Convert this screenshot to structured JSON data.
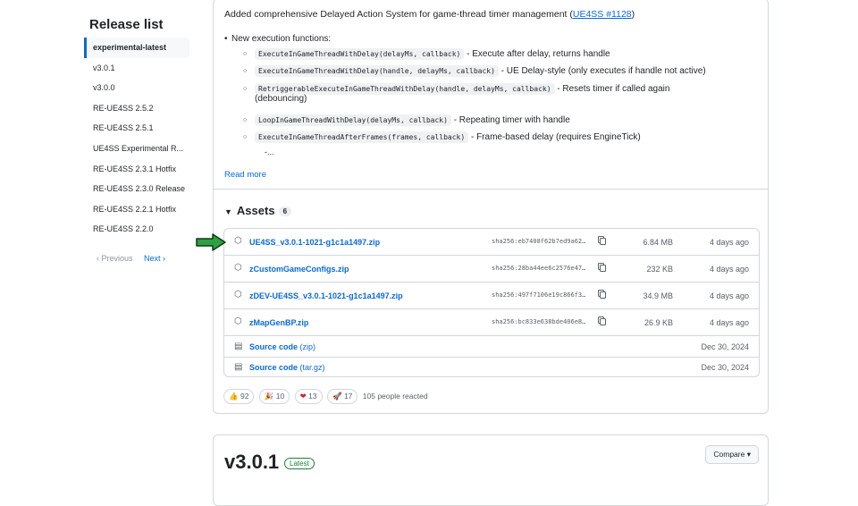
{
  "sidebar": {
    "title": "Release list",
    "items": [
      {
        "label": "experimental-latest",
        "active": true
      },
      {
        "label": "v3.0.1"
      },
      {
        "label": "v3.0.0"
      },
      {
        "label": "RE-UE4SS 2.5.2"
      },
      {
        "label": "RE-UE4SS 2.5.1"
      },
      {
        "label": "UE4SS Experimental R..."
      },
      {
        "label": "RE-UE4SS 2.3.1 Hotfix"
      },
      {
        "label": "RE-UE4SS 2.3.0 Release"
      },
      {
        "label": "RE-UE4SS 2.2.1 Hotfix"
      },
      {
        "label": "RE-UE4SS 2.2.0"
      }
    ],
    "prev_label": "Previous",
    "next_label": "Next"
  },
  "release": {
    "intro_text": "Added comprehensive Delayed Action System for game-thread timer management (",
    "intro_link": "UE4SS #1128",
    "intro_end": ")",
    "bullet": "New execution functions:",
    "subitems": [
      {
        "code": "ExecuteInGameThreadWithDelay(delayMs, callback)",
        "desc": " - Execute after delay, returns handle"
      },
      {
        "code": "ExecuteInGameThreadWithDelay(handle, delayMs, callback)",
        "desc": " - UE Delay-style (only executes if handle not active)"
      },
      {
        "code": "RetriggerableExecuteInGameThreadWithDelay(handle, delayMs, callback)",
        "desc": " - Resets timer if called again",
        "desc2": "(debouncing)"
      },
      {
        "code": "LoopInGameThreadWithDelay(delayMs, callback)",
        "desc": " - Repeating timer with handle"
      },
      {
        "code": "ExecuteInGameThreadAfterFrames(frames, callback)",
        "desc": " - Frame-based delay (requires EngineTick)"
      }
    ],
    "ellipsis": "-...",
    "read_more": "Read more"
  },
  "assets": {
    "heading": "Assets",
    "count": "6",
    "files": [
      {
        "name": "UE4SS_v3.0.1-1021-g1c1a1497.zip",
        "sha": "sha256:eb7408f62b7ed9a62…",
        "size": "6.84 MB",
        "date": "4 days ago",
        "icon": "package-icon"
      },
      {
        "name": "zCustomGameConfigs.zip",
        "sha": "sha256:28ba44ee6c2576e47…",
        "size": "232 KB",
        "date": "4 days ago",
        "icon": "package-icon"
      },
      {
        "name": "zDEV-UE4SS_v3.0.1-1021-g1c1a1497.zip",
        "sha": "sha256:497f7106e19c866f3…",
        "size": "34.9 MB",
        "date": "4 days ago",
        "icon": "package-icon"
      },
      {
        "name": "zMapGenBP.zip",
        "sha": "sha256:bc833e638bde406e8…",
        "size": "26.9 KB",
        "date": "4 days ago",
        "icon": "package-icon"
      }
    ],
    "source": [
      {
        "name": "Source code",
        "suffix": "(zip)",
        "date": "Dec 30, 2024",
        "icon": "file-zip-icon"
      },
      {
        "name": "Source code",
        "suffix": "(tar.gz)",
        "date": "Dec 30, 2024",
        "icon": "file-zip-icon"
      }
    ]
  },
  "reactions": {
    "items": [
      {
        "emoji": "👍",
        "count": "92"
      },
      {
        "emoji": "🎉",
        "count": "10"
      },
      {
        "emoji": "❤",
        "count": "13"
      },
      {
        "emoji": "🚀",
        "count": "17"
      }
    ],
    "summary": "105 people reacted"
  },
  "next_release": {
    "version": "v3.0.1",
    "badge": "Latest",
    "compare_label": "Compare"
  },
  "colors": {
    "link": "#0969da",
    "border": "#d0d7de",
    "arrow": "#2ea043",
    "latest": "#1a7f37"
  }
}
